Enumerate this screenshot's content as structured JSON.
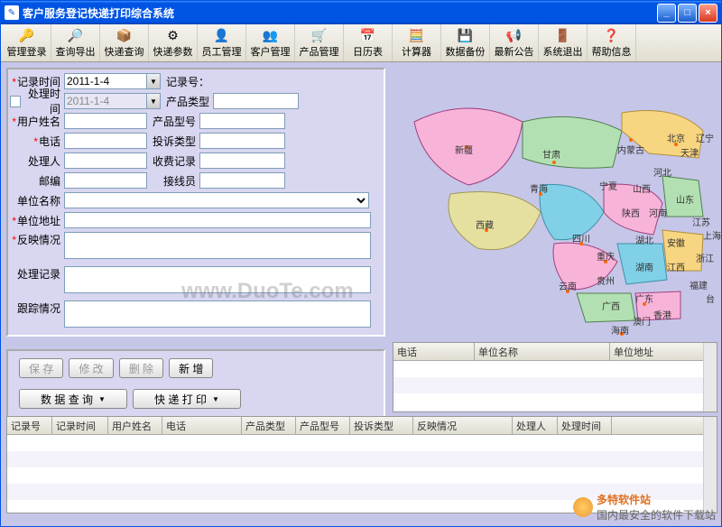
{
  "window": {
    "title": "客户服务登记快递打印综合系统"
  },
  "toolbar": [
    {
      "label": "管理登录",
      "icon": "🔑"
    },
    {
      "label": "查询导出",
      "icon": "🔎"
    },
    {
      "label": "快递查询",
      "icon": "📦"
    },
    {
      "label": "快递参数",
      "icon": "⚙"
    },
    {
      "label": "员工管理",
      "icon": "👤"
    },
    {
      "label": "客户管理",
      "icon": "👥"
    },
    {
      "label": "产品管理",
      "icon": "🛒"
    },
    {
      "label": "日历表",
      "icon": "📅"
    },
    {
      "label": "计算器",
      "icon": "🧮"
    },
    {
      "label": "数据备份",
      "icon": "💾"
    },
    {
      "label": "最新公告",
      "icon": "📢"
    },
    {
      "label": "系统退出",
      "icon": "🚪"
    },
    {
      "label": "帮助信息",
      "icon": "❓"
    }
  ],
  "form": {
    "record_time_lbl": "记录时间",
    "record_time": "2011-1-4",
    "record_no_lbl": "记录号：",
    "record_no": "",
    "handle_time_lbl": "处理时间",
    "handle_time": "2011-1-4",
    "product_type_lbl": "产品类型",
    "username_lbl": "用户姓名",
    "product_model_lbl": "产品型号",
    "phone_lbl": "电话",
    "complaint_type_lbl": "投诉类型",
    "handler_lbl": "处理人",
    "fee_record_lbl": "收费记录",
    "postcode_lbl": "邮编",
    "operator_lbl": "接线员",
    "unit_name_lbl": "单位名称",
    "unit_addr_lbl": "单位地址",
    "feedback_lbl": "反映情况",
    "handle_rec_lbl": "处理记录",
    "track_lbl": "跟踪情况"
  },
  "buttons": {
    "save": "保 存",
    "modify": "修 改",
    "delete": "删 除",
    "add": "新 增",
    "query": "数 据 查 询",
    "print": "快 递 打 印"
  },
  "grid1_headers": [
    "记录号",
    "记录时间",
    "用户姓名",
    "电话",
    "产品类型",
    "产品型号",
    "投诉类型",
    "反映情况",
    "处理人",
    "处理时间"
  ],
  "grid2_headers": [
    "电话",
    "单位名称",
    "单位地址"
  ],
  "watermark": "www.DuoTe.com",
  "footer": {
    "brand": "多特软件站",
    "slogan": "国内最安全的软件下载站"
  },
  "provinces": [
    "新疆",
    "甘肃",
    "内蒙古",
    "北京",
    "辽宁",
    "天津",
    "青海",
    "宁夏",
    "河北",
    "山西",
    "西藏",
    "陕西",
    "河南",
    "山东",
    "江苏",
    "上海",
    "四川",
    "湖北",
    "安徽",
    "重庆",
    "湖南",
    "江西",
    "浙江",
    "云南",
    "贵州",
    "福建",
    "广西",
    "广东",
    "台湾",
    "香港",
    "澳门",
    "海南"
  ]
}
